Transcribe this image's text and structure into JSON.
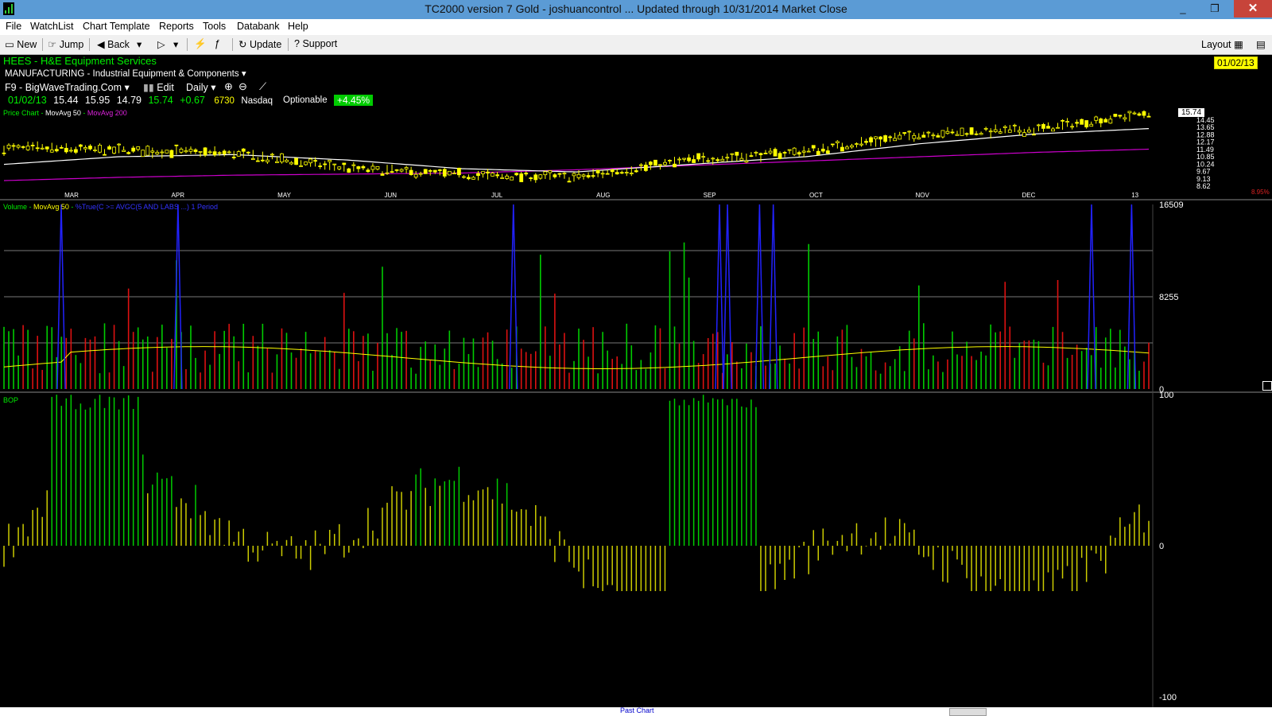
{
  "window": {
    "title": "TC2000 version 7 Gold - joshuancontrol  ... Updated through 10/31/2014  Market Close",
    "minimize": "_",
    "restore": "❐",
    "close": "✕"
  },
  "menu": [
    "File",
    "WatchList",
    "Chart Template",
    "Reports",
    "Tools",
    "Databank",
    "Help"
  ],
  "toolbar": {
    "new": "New",
    "jump": "Jump",
    "back": "Back",
    "update": "Update",
    "support": "Support",
    "layout": "Layout"
  },
  "symbol": {
    "ticker_name": "HEES - H&E Equipment Services",
    "industry": "MANUFACTURING - Industrial Equipment & Components",
    "watchlist": "F9 - BigWaveTrading.Com",
    "edit": "Edit",
    "period": "Daily",
    "date": "01/02/13",
    "open": "15.44",
    "high": "15.95",
    "low": "14.79",
    "close": "15.74",
    "change": "+0.67",
    "volume": "6730",
    "exchange": "Nasdaq",
    "optionable": "Optionable",
    "pct_change": "+4.45%",
    "date_badge": "01/02/13"
  },
  "price_panel": {
    "label": "Price Chart",
    "ma50": "MovAvg 50",
    "ma200": "MovAvg 200",
    "last_price": "15.74",
    "axis_ticks": [
      "14.45",
      "13.65",
      "12.88",
      "12.17",
      "11.49",
      "10.85",
      "10.24",
      "9.67",
      "9.13",
      "8.62"
    ],
    "extra_right": "8.95%",
    "months": [
      "MAR",
      "APR",
      "MAY",
      "JUN",
      "JUL",
      "AUG",
      "SEP",
      "OCT",
      "NOV",
      "DEC",
      "13"
    ]
  },
  "volume_panel": {
    "label": "Volume",
    "ma50": "MovAvg 50",
    "pcf": "%True(C >= AVGC(5 AND LABS ...) 1 Period",
    "ticks": [
      "16509",
      "8255",
      "0"
    ]
  },
  "bop_panel": {
    "label": "BOP",
    "ticks": [
      "100",
      "0",
      "-100"
    ]
  },
  "footer": {
    "past_chart": "Past Chart"
  },
  "colors": {
    "up": "#00cc00",
    "down": "#dd1111",
    "candle": "#ffff00",
    "ma50": "#ffffff",
    "ma200": "#cc00cc",
    "vol_ma": "#ffff00",
    "pcf": "#2222ff",
    "bop_pos_strong": "#00cc00",
    "bop_weak": "#cccc00"
  },
  "chart_data": {
    "type": "line",
    "title": "HEES - H&E Equipment Services",
    "xlabel": "",
    "ylabel": "",
    "x": [
      "MAR",
      "APR",
      "MAY",
      "JUN",
      "JUL",
      "AUG",
      "SEP",
      "OCT",
      "NOV",
      "DEC",
      "13"
    ],
    "ylim": [
      8.62,
      15.74
    ],
    "series": [
      {
        "name": "Price Chart",
        "values": [
          12.5,
          12.3,
          12.0,
          10.6,
          10.0,
          9.8,
          11.4,
          12.2,
          13.8,
          14.2,
          15.74
        ]
      },
      {
        "name": "MovAvg 50",
        "values": [
          11.0,
          11.7,
          11.9,
          11.4,
          10.6,
          10.3,
          11.0,
          11.7,
          12.9,
          13.8,
          14.3
        ]
      },
      {
        "name": "MovAvg 200",
        "values": [
          9.5,
          9.8,
          10.0,
          10.1,
          10.2,
          10.5,
          10.9,
          11.3,
          11.7,
          12.1,
          12.4
        ]
      }
    ]
  }
}
